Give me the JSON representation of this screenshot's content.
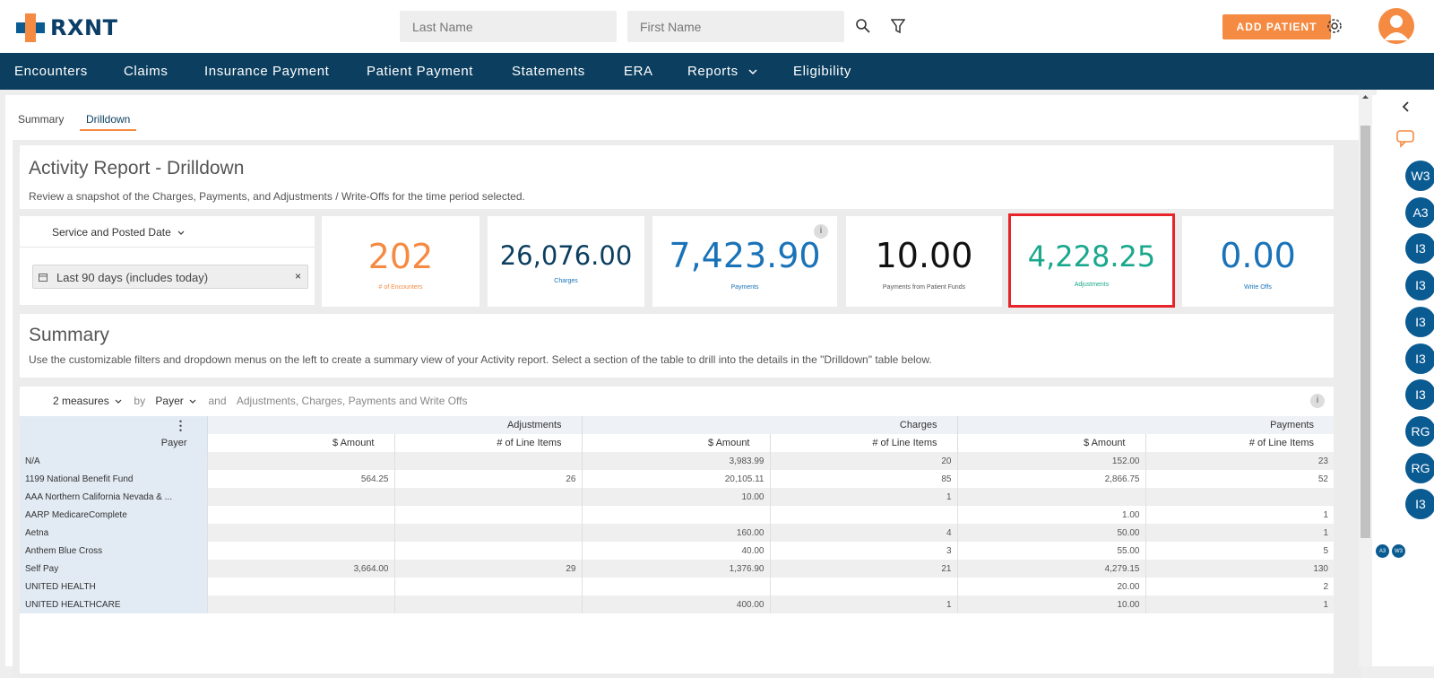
{
  "brand": {
    "name": "RXNT"
  },
  "header": {
    "last_name_placeholder": "Last Name",
    "first_name_placeholder": "First Name",
    "add_patient_label": "ADD PATIENT"
  },
  "nav": {
    "items": [
      "Encounters",
      "Claims",
      "Insurance Payment",
      "Patient Payment",
      "Statements",
      "ERA",
      "Reports",
      "Eligibility"
    ]
  },
  "tabs": [
    "Summary",
    "Drilldown"
  ],
  "activity": {
    "title": "Activity Report - Drilldown",
    "subtitle": "Review a snapshot of the Charges, Payments, and Adjustments / Write-Offs for the time period selected."
  },
  "filter": {
    "date_type": "Service and Posted Date",
    "date_range": "Last 90 days (includes today)"
  },
  "kpis": [
    {
      "value": "202",
      "label": "# of Encounters",
      "color": "#f58a42"
    },
    {
      "value": "26,076.00",
      "label": "Charges",
      "color": "#0b3e5f"
    },
    {
      "value": "7,423.90",
      "label": "Payments",
      "color": "#1a73b8"
    },
    {
      "value": "10.00",
      "label": "Payments from Patient Funds",
      "color": "#111111"
    },
    {
      "value": "4,228.25",
      "label": "Adjustments",
      "color": "#1aa88c"
    },
    {
      "value": "0.00",
      "label": "Write Offs",
      "color": "#1a73b8"
    }
  ],
  "summary": {
    "title": "Summary",
    "subtitle": "Use the customizable filters and dropdown menus on the left to create a summary view of your Activity report. Select a section of the table to drill into the details in the \"Drilldown\" table below."
  },
  "pivot_bar": {
    "measures": "2 measures",
    "by": "by",
    "dimension": "Payer",
    "and": "and",
    "columns": "Adjustments, Charges, Payments and Write Offs"
  },
  "table": {
    "row_header": "Payer",
    "groups": [
      "Adjustments",
      "Charges",
      "Payments"
    ],
    "sub_headers": [
      "$ Amount",
      "# of Line Items"
    ],
    "rows": [
      {
        "payer": "N/A",
        "adj_amt": "",
        "adj_cnt": "",
        "chg_amt": "3,983.99",
        "chg_cnt": "20",
        "pay_amt": "152.00",
        "pay_cnt": "23"
      },
      {
        "payer": "1199 National Benefit Fund",
        "adj_amt": "564.25",
        "adj_cnt": "26",
        "chg_amt": "20,105.11",
        "chg_cnt": "85",
        "pay_amt": "2,866.75",
        "pay_cnt": "52"
      },
      {
        "payer": "AAA Northern California Nevada & ...",
        "adj_amt": "",
        "adj_cnt": "",
        "chg_amt": "10.00",
        "chg_cnt": "1",
        "pay_amt": "",
        "pay_cnt": ""
      },
      {
        "payer": "AARP MedicareComplete",
        "adj_amt": "",
        "adj_cnt": "",
        "chg_amt": "",
        "chg_cnt": "",
        "pay_amt": "1.00",
        "pay_cnt": "1"
      },
      {
        "payer": "Aetna",
        "adj_amt": "",
        "adj_cnt": "",
        "chg_amt": "160.00",
        "chg_cnt": "4",
        "pay_amt": "50.00",
        "pay_cnt": "1"
      },
      {
        "payer": "Anthem Blue Cross",
        "adj_amt": "",
        "adj_cnt": "",
        "chg_amt": "40.00",
        "chg_cnt": "3",
        "pay_amt": "55.00",
        "pay_cnt": "5"
      },
      {
        "payer": "Self Pay",
        "adj_amt": "3,664.00",
        "adj_cnt": "29",
        "chg_amt": "1,376.90",
        "chg_cnt": "21",
        "pay_amt": "4,279.15",
        "pay_cnt": "130"
      },
      {
        "payer": "UNITED HEALTH",
        "adj_amt": "",
        "adj_cnt": "",
        "chg_amt": "",
        "chg_cnt": "",
        "pay_amt": "20.00",
        "pay_cnt": "2"
      },
      {
        "payer": "UNITED HEALTHCARE",
        "adj_amt": "",
        "adj_cnt": "",
        "chg_amt": "400.00",
        "chg_cnt": "1",
        "pay_amt": "10.00",
        "pay_cnt": "1"
      }
    ]
  },
  "rail": {
    "badges": [
      "W3",
      "A3",
      "I3",
      "I3",
      "I3",
      "I3",
      "I3",
      "RG",
      "RG",
      "I3"
    ],
    "mini_badges": [
      "A3",
      "W3"
    ]
  },
  "colors": {
    "navy": "#0b3e5f",
    "orange": "#f58a42",
    "highlight": "#e8242b"
  }
}
